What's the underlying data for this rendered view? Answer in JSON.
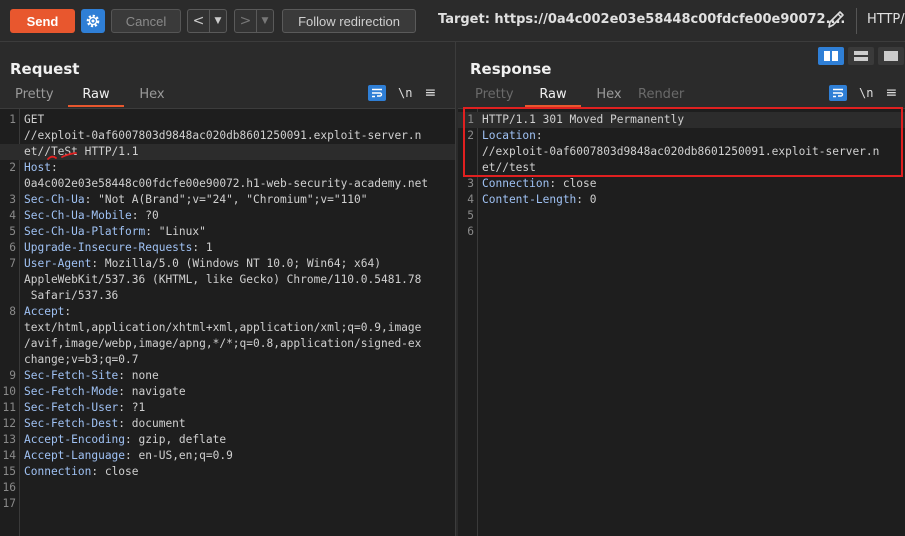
{
  "toolbar": {
    "send_label": "Send",
    "cancel_label": "Cancel",
    "back_arrow": "<",
    "forward_arrow": ">",
    "dropdown_glyph": "▼",
    "follow_label": "Follow redirection",
    "target_text": "Target: https://0a4c002e03e58448c00fdcfe00e90072....",
    "http_version": "HTTP/"
  },
  "request": {
    "title": "Request",
    "tabs": [
      "Pretty",
      "Raw",
      "Hex"
    ],
    "active_tab": "Raw",
    "newline_label": "\\n",
    "menu_glyph": "≡",
    "lines": [
      {
        "n": "1",
        "parts": [
          [
            "t",
            "GET"
          ]
        ]
      },
      {
        "n": "",
        "parts": [
          [
            "t",
            "//exploit-0af6007803d9848ac020db8601250091.exploit-server.n"
          ]
        ]
      },
      {
        "n": "",
        "parts": [
          [
            "t",
            "et//TeSt HTTP/1.1"
          ]
        ]
      },
      {
        "n": "2",
        "parts": [
          [
            "h",
            "Host"
          ],
          [
            "t",
            ":"
          ]
        ]
      },
      {
        "n": "",
        "parts": [
          [
            "t",
            "0a4c002e03e58448c00fdcfe00e90072.h1-web-security-academy.net"
          ]
        ]
      },
      {
        "n": "3",
        "parts": [
          [
            "h",
            "Sec-Ch-Ua"
          ],
          [
            "t",
            ": \"Not A(Brand\";v=\"24\", \"Chromium\";v=\"110\""
          ]
        ]
      },
      {
        "n": "4",
        "parts": [
          [
            "h",
            "Sec-Ch-Ua-Mobile"
          ],
          [
            "t",
            ": ?0"
          ]
        ]
      },
      {
        "n": "5",
        "parts": [
          [
            "h",
            "Sec-Ch-Ua-Platform"
          ],
          [
            "t",
            ": \"Linux\""
          ]
        ]
      },
      {
        "n": "6",
        "parts": [
          [
            "h",
            "Upgrade-Insecure-Requests"
          ],
          [
            "t",
            ": 1"
          ]
        ]
      },
      {
        "n": "7",
        "parts": [
          [
            "h",
            "User-Agent"
          ],
          [
            "t",
            ": Mozilla/5.0 (Windows NT 10.0; Win64; x64)"
          ]
        ]
      },
      {
        "n": "",
        "parts": [
          [
            "t",
            "AppleWebKit/537.36 (KHTML, like Gecko) Chrome/110.0.5481.78"
          ]
        ]
      },
      {
        "n": "",
        "parts": [
          [
            "t",
            " Safari/537.36"
          ]
        ]
      },
      {
        "n": "8",
        "parts": [
          [
            "h",
            "Accept"
          ],
          [
            "t",
            ":"
          ]
        ]
      },
      {
        "n": "",
        "parts": [
          [
            "t",
            "text/html,application/xhtml+xml,application/xml;q=0.9,image"
          ]
        ]
      },
      {
        "n": "",
        "parts": [
          [
            "t",
            "/avif,image/webp,image/apng,*/*;q=0.8,application/signed-ex"
          ]
        ]
      },
      {
        "n": "",
        "parts": [
          [
            "t",
            "change;v=b3;q=0.7"
          ]
        ]
      },
      {
        "n": "9",
        "parts": [
          [
            "h",
            "Sec-Fetch-Site"
          ],
          [
            "t",
            ": none"
          ]
        ]
      },
      {
        "n": "10",
        "parts": [
          [
            "h",
            "Sec-Fetch-Mode"
          ],
          [
            "t",
            ": navigate"
          ]
        ]
      },
      {
        "n": "11",
        "parts": [
          [
            "h",
            "Sec-Fetch-User"
          ],
          [
            "t",
            ": ?1"
          ]
        ]
      },
      {
        "n": "12",
        "parts": [
          [
            "h",
            "Sec-Fetch-Dest"
          ],
          [
            "t",
            ": document"
          ]
        ]
      },
      {
        "n": "13",
        "parts": [
          [
            "h",
            "Accept-Encoding"
          ],
          [
            "t",
            ": gzip, deflate"
          ]
        ]
      },
      {
        "n": "14",
        "parts": [
          [
            "h",
            "Accept-Language"
          ],
          [
            "t",
            ": en-US,en;q=0.9"
          ]
        ]
      },
      {
        "n": "15",
        "parts": [
          [
            "h",
            "Connection"
          ],
          [
            "t",
            ": close"
          ]
        ]
      },
      {
        "n": "16",
        "parts": []
      },
      {
        "n": "17",
        "parts": []
      }
    ]
  },
  "response": {
    "title": "Response",
    "tabs": [
      "Pretty",
      "Raw",
      "Hex",
      "Render"
    ],
    "active_tab": "Raw",
    "newline_label": "\\n",
    "menu_glyph": "≡",
    "lines": [
      {
        "n": "1",
        "parts": [
          [
            "t",
            "HTTP/1.1 301 Moved Permanently"
          ]
        ]
      },
      {
        "n": "2",
        "parts": [
          [
            "h",
            "Location"
          ],
          [
            "t",
            ":"
          ]
        ]
      },
      {
        "n": "",
        "parts": [
          [
            "t",
            "//exploit-0af6007803d9848ac020db8601250091.exploit-server.n"
          ]
        ]
      },
      {
        "n": "",
        "parts": [
          [
            "t",
            "et//test"
          ]
        ]
      },
      {
        "n": "3",
        "parts": [
          [
            "h",
            "Connection"
          ],
          [
            "t",
            ": close"
          ]
        ]
      },
      {
        "n": "4",
        "parts": [
          [
            "h",
            "Content-Length"
          ],
          [
            "t",
            ": 0"
          ]
        ]
      },
      {
        "n": "5",
        "parts": []
      },
      {
        "n": "6",
        "parts": []
      }
    ]
  },
  "colors": {
    "accent": "#e8572e",
    "blue": "#2f7fd6",
    "header_name": "#9fc1f3",
    "highlight_box": "#e02020"
  }
}
